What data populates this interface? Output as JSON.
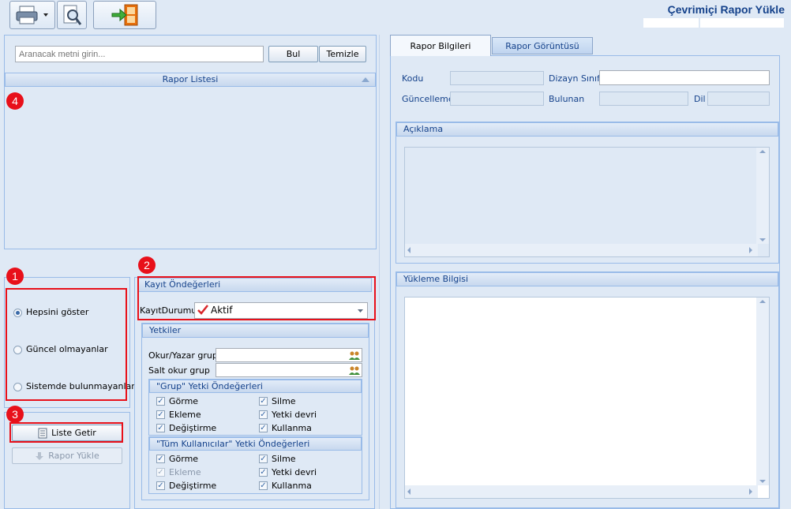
{
  "app": {
    "title": "Çevrimiçi Rapor Yükle"
  },
  "toolbar": {
    "print_icon": "printer-icon",
    "settings_icon": "magnifier-settings-icon",
    "exit_icon": "exit-door-icon"
  },
  "search": {
    "placeholder": "Aranacak metni girin...",
    "find_label": "Bul",
    "clear_label": "Temizle"
  },
  "report_list": {
    "header": "Rapor Listesi"
  },
  "filters": {
    "options": [
      "Hepsini göster",
      "Güncel olmayanlar",
      "Sistemde bulunmayanlar"
    ],
    "selected": 0
  },
  "actions": {
    "list_label": "Liste Getir",
    "upload_label": "Rapor Yükle"
  },
  "defaults": {
    "header": "Kayıt Öndeğerleri",
    "status_label": "KayıtDurumu",
    "status_value": "Aktif"
  },
  "permissions": {
    "header": "Yetkiler",
    "rw_group_label": "Okur/Yazar grup",
    "ro_group_label": "Salt okur grup",
    "group_header": "\"Grup\" Yetki Öndeğerleri",
    "all_users_header": "\"Tüm Kullanıcılar\" Yetki Öndeğerleri",
    "group_items": [
      {
        "label": "Görme",
        "checked": true
      },
      {
        "label": "Silme",
        "checked": true
      },
      {
        "label": "Ekleme",
        "checked": true
      },
      {
        "label": "Yetki devri",
        "checked": true
      },
      {
        "label": "Değiştirme",
        "checked": true
      },
      {
        "label": "Kullanma",
        "checked": true
      }
    ],
    "all_items": [
      {
        "label": "Görme",
        "checked": true
      },
      {
        "label": "Silme",
        "checked": true
      },
      {
        "label": "Ekleme",
        "checked": true
      },
      {
        "label": "Yetki devri",
        "checked": true
      },
      {
        "label": "Değiştirme",
        "checked": true
      },
      {
        "label": "Kullanma",
        "checked": true
      }
    ]
  },
  "tabs": [
    "Rapor Bilgileri",
    "Rapor Görüntüsü"
  ],
  "info": {
    "code_label": "Kodu",
    "design_class_label": "Dizayn Sınıfı",
    "updated_label": "Güncelleme",
    "found_label": "Bulunan",
    "lang_label": "Dil"
  },
  "description": {
    "header": "Açıklama"
  },
  "upload_info": {
    "header": "Yükleme Bilgisi"
  },
  "callouts": [
    "1",
    "2",
    "3",
    "4"
  ],
  "colors": {
    "accent": "#15428b",
    "highlight": "#e8101a",
    "panel": "#dfe9f5"
  }
}
